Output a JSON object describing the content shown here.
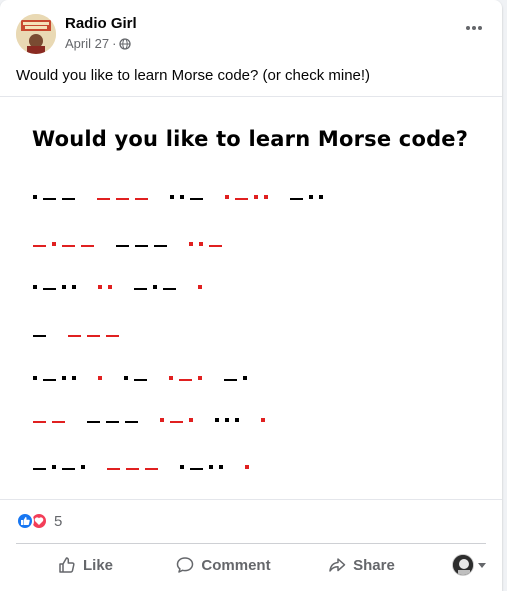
{
  "post": {
    "author": "Radio Girl",
    "date": "April 27",
    "dot": "·",
    "privacy_icon": "globe-icon",
    "more_icon": "more-options-icon",
    "text": "Would you like to learn Morse code? (or check mine!)"
  },
  "image": {
    "title": "Would you like to learn Morse code?",
    "colors": {
      "black": "#000000",
      "red": "#e02020"
    },
    "rows": [
      [
        {
          "code": ".--",
          "color": "black"
        },
        {
          "code": "---",
          "color": "red"
        },
        {
          "code": "..-",
          "color": "black"
        },
        {
          "code": ".-..",
          "color": "red"
        },
        {
          "code": "-..",
          "color": "black"
        }
      ],
      [
        {
          "code": "-.--",
          "color": "red"
        },
        {
          "code": "---",
          "color": "black"
        },
        {
          "code": "..-",
          "color": "red"
        }
      ],
      [
        {
          "code": ".-..",
          "color": "black"
        },
        {
          "code": "..",
          "color": "red"
        },
        {
          "code": "-.-",
          "color": "black"
        },
        {
          "code": ".",
          "color": "red"
        }
      ],
      [
        {
          "code": "-",
          "color": "black"
        },
        {
          "code": "---",
          "color": "red"
        }
      ],
      [
        {
          "code": ".-..",
          "color": "black"
        },
        {
          "code": ".",
          "color": "red"
        },
        {
          "code": ".-",
          "color": "black"
        },
        {
          "code": ".-.",
          "color": "red"
        },
        {
          "code": "-.",
          "color": "black"
        }
      ],
      [
        {
          "code": "--",
          "color": "red"
        },
        {
          "code": "---",
          "color": "black"
        },
        {
          "code": ".-.",
          "color": "red"
        },
        {
          "code": "...",
          "color": "black"
        },
        {
          "code": ".",
          "color": "red"
        }
      ],
      [
        {
          "code": "-.-.",
          "color": "black"
        },
        {
          "code": "---",
          "color": "red"
        },
        {
          "code": ".-..",
          "color": "black"
        },
        {
          "code": ".",
          "color": "red"
        }
      ]
    ]
  },
  "reactions": {
    "icons": [
      "like-reaction-icon",
      "love-reaction-icon"
    ],
    "count": "5",
    "like_color": "#1877f2",
    "love_color": "#f33e58"
  },
  "actions": {
    "like": "Like",
    "comment": "Comment",
    "share": "Share"
  },
  "theme": {
    "text_primary": "#050505",
    "text_secondary": "#65676b",
    "divider": "#ced0d4"
  }
}
